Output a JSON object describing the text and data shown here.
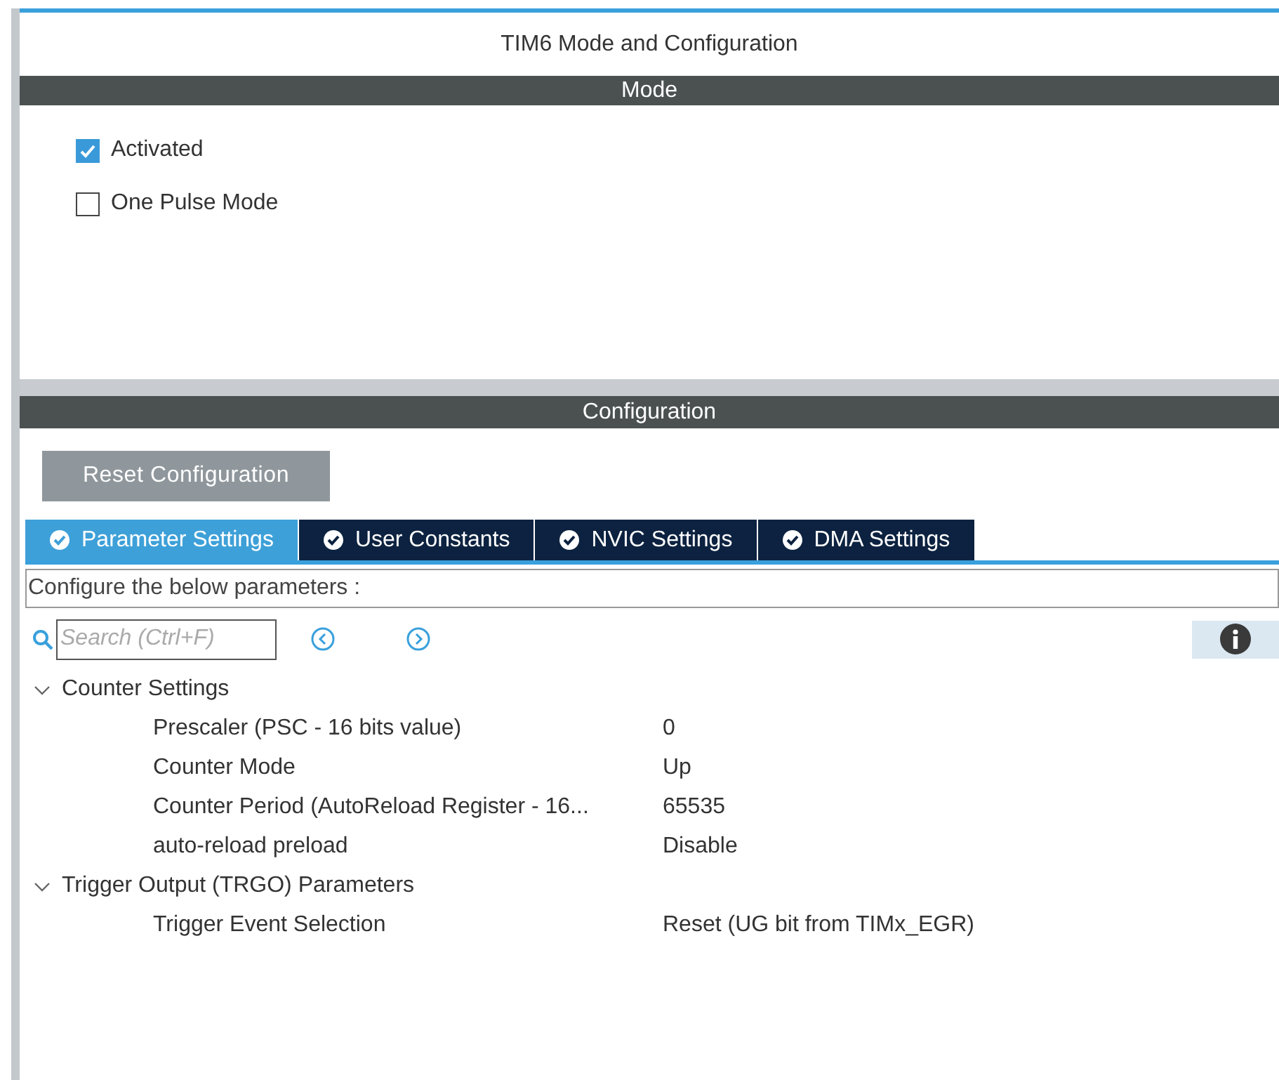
{
  "window": {
    "title": "TIM6 Mode and Configuration"
  },
  "mode": {
    "header": "Mode",
    "options": [
      {
        "label": "Activated",
        "checked": true
      },
      {
        "label": "One Pulse Mode",
        "checked": false
      }
    ]
  },
  "configuration": {
    "header": "Configuration",
    "reset_button": "Reset Configuration",
    "tabs": [
      {
        "label": "Parameter Settings",
        "selected": true
      },
      {
        "label": "User Constants",
        "selected": false
      },
      {
        "label": "NVIC Settings",
        "selected": false
      },
      {
        "label": "DMA Settings",
        "selected": false
      }
    ],
    "description": "Configure the below parameters :",
    "search": {
      "placeholder": "Search (Ctrl+F)"
    },
    "groups": [
      {
        "label": "Counter Settings",
        "expanded": true,
        "children": [
          {
            "name": "Prescaler (PSC - 16 bits value)",
            "value": "0"
          },
          {
            "name": "Counter Mode",
            "value": "Up"
          },
          {
            "name": "Counter Period (AutoReload Register - 16...",
            "value": "65535"
          },
          {
            "name": "auto-reload preload",
            "value": "Disable"
          }
        ]
      },
      {
        "label": "Trigger Output (TRGO) Parameters",
        "expanded": true,
        "children": [
          {
            "name": "Trigger Event Selection",
            "value": "Reset (UG bit from TIMx_EGR)"
          }
        ]
      }
    ]
  }
}
